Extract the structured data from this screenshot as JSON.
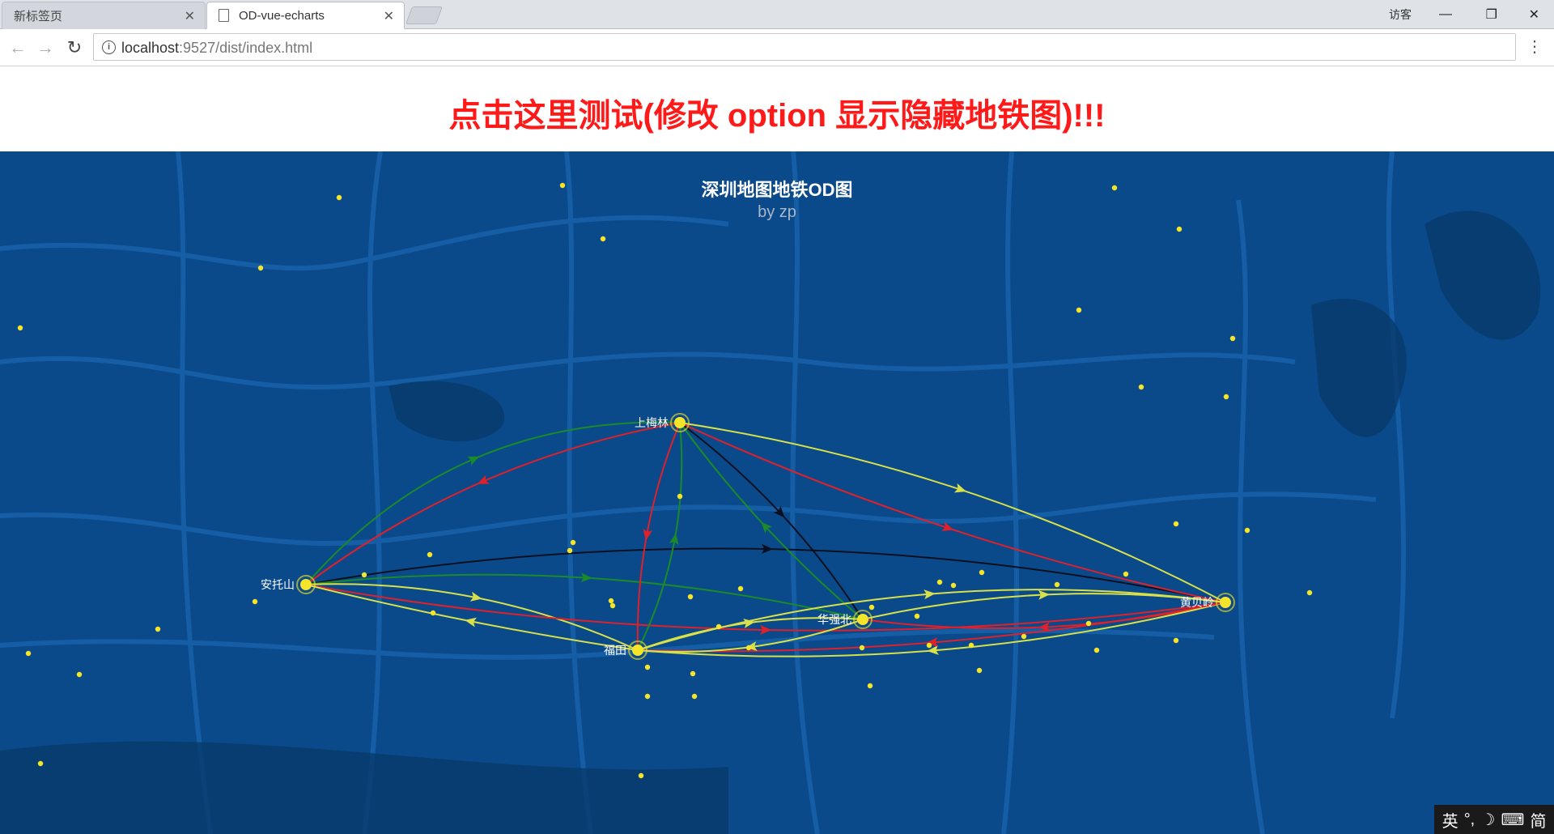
{
  "browser": {
    "tabs": [
      {
        "label": "新标签页",
        "active": false
      },
      {
        "label": "OD-vue-echarts",
        "active": true
      }
    ],
    "incognito_label": "访客",
    "url_host": "localhost",
    "url_rest": ":9527/dist/index.html"
  },
  "page": {
    "headline": "点击这里测试(修改 option 显示隐藏地铁图)!!!"
  },
  "map": {
    "title": "深圳地图地铁OD图",
    "subtitle": "by zp",
    "stations": [
      {
        "name": "上梅林",
        "id": "shangmeilin"
      },
      {
        "name": "安托山",
        "id": "antuoshan"
      },
      {
        "name": "福田",
        "id": "futian"
      },
      {
        "name": "华强北",
        "id": "huaqiangbei"
      },
      {
        "name": "黄贝岭",
        "id": "huangbeiling"
      }
    ],
    "colors": {
      "background": "#0a4a8a",
      "roads": "#1a66b0",
      "station": "#f5e52a",
      "flow_yellow": "#d8e04a",
      "flow_red": "#e0202a",
      "flow_green": "#1a8a2a",
      "flow_black": "#0a1020"
    }
  },
  "ime": {
    "lang": "英",
    "punct": "°,",
    "moon": "☽",
    "keyboard": "⌨",
    "mode": "简"
  }
}
